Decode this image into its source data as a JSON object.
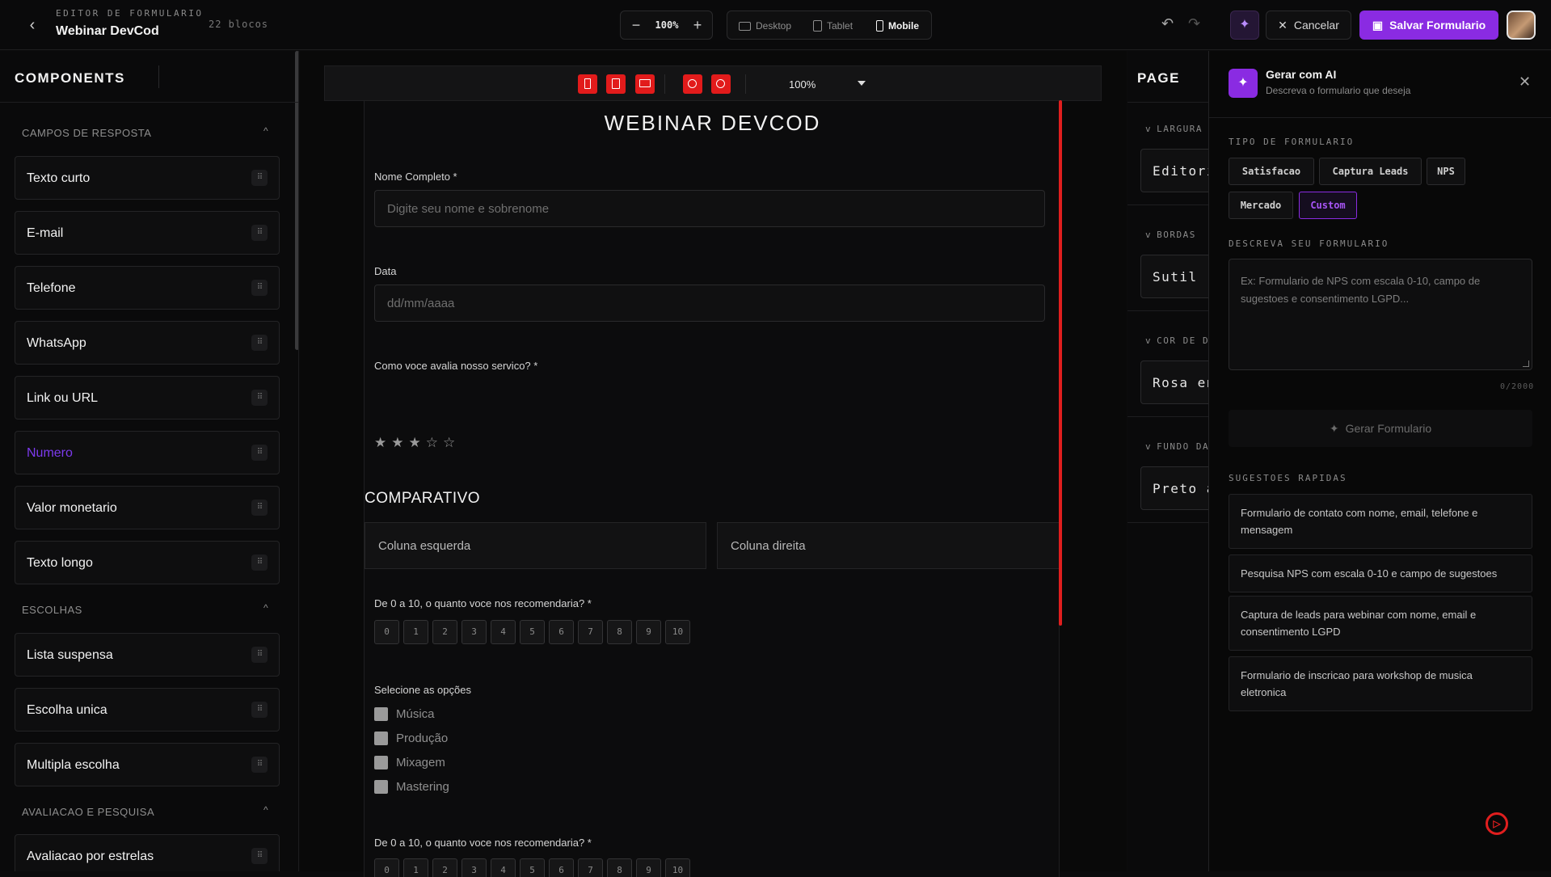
{
  "header": {
    "subtitle": "EDITOR DE FORMULARIO",
    "title": "Webinar DevCod",
    "blocks_count": "22 blocos",
    "zoom": "100%",
    "devices": [
      "Desktop",
      "Tablet",
      "Mobile"
    ],
    "active_device": "Mobile",
    "cancel_label": "Cancelar",
    "save_label": "Salvar Formulario"
  },
  "components": {
    "title": "COMPONENTS",
    "sections": [
      {
        "title": "CAMPOS DE RESPOSTA",
        "items": [
          "Texto curto",
          "E-mail",
          "Telefone",
          "WhatsApp",
          "Link ou URL",
          "Numero",
          "Valor monetario",
          "Texto longo"
        ]
      },
      {
        "title": "ESCOLHAS",
        "items": [
          "Lista suspensa",
          "Escolha unica",
          "Multipla escolha"
        ]
      },
      {
        "title": "AVALIACAO E PESQUISA",
        "items": [
          "Avaliacao por estrelas"
        ]
      }
    ]
  },
  "canvas": {
    "zoom": "100%",
    "form_title": "WEBINAR DEVCOD",
    "name_label": "Nome Completo *",
    "name_placeholder": "Digite seu nome e sobrenome",
    "date_label": "Data",
    "date_placeholder": "dd/mm/aaaa",
    "rating_label": "Como voce avalia nosso servico? *",
    "rating_stars": "★★★☆☆",
    "section_title": "COMPARATIVO",
    "col_left": "Coluna esquerda",
    "col_right": "Coluna direita",
    "nps_label": "De 0 a 10, o quanto voce nos recomendaria? *",
    "nps_scale": [
      "0",
      "1",
      "2",
      "3",
      "4",
      "5",
      "6",
      "7",
      "8",
      "9",
      "10"
    ],
    "options_label": "Selecione as opções",
    "options": [
      "Música",
      "Produção",
      "Mixagem",
      "Mastering"
    ],
    "nps_label_2": "De 0 a 10, o quanto voce nos recomendaria? *"
  },
  "page": {
    "title": "PAGE",
    "sections": [
      {
        "label": "LARGURA",
        "value": "Editori"
      },
      {
        "label": "BORDAS",
        "value": "Sutil"
      },
      {
        "label": "COR DE D",
        "value": "Rosa en"
      },
      {
        "label": "FUNDO DA",
        "value": "Preto a"
      }
    ]
  },
  "ai": {
    "title": "Gerar com AI",
    "subtitle": "Descreva o formulario que deseja",
    "type_label": "TIPO DE FORMULARIO",
    "types": [
      "Satisfacao",
      "Captura Leads",
      "NPS",
      "Mercado",
      "Custom"
    ],
    "active_type": "Custom",
    "describe_label": "DESCREVA SEU FORMULARIO",
    "describe_placeholder": "Ex: Formulario de NPS com escala 0-10, campo de sugestoes e consentimento LGPD...",
    "char_count": "0/2000",
    "generate_label": "Gerar Formulario",
    "suggestions_label": "SUGESTOES RAPIDAS",
    "suggestions": [
      "Formulario de contato com nome, email, telefone e mensagem",
      "Pesquisa NPS com escala 0-10 e campo de sugestoes",
      "Captura de leads para webinar com nome, email e consentimento LGPD",
      "Formulario de inscricao para workshop de musica eletronica"
    ]
  },
  "colors": {
    "accent": "#8a2be2",
    "danger": "#e01e1e",
    "background": "#0b0b0c"
  }
}
